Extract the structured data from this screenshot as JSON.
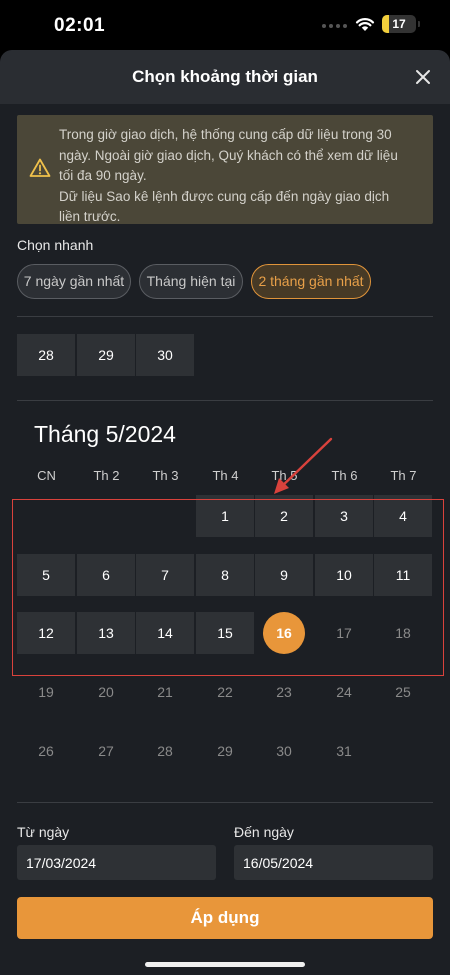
{
  "status_bar": {
    "time": "02:01",
    "battery": "17",
    "battery_level": 0.17,
    "battery_color": "#f2cf3c"
  },
  "sheet": {
    "title": "Chọn khoảng thời gian",
    "close_icon": "close-icon"
  },
  "notice": {
    "icon": "warning-icon",
    "lines": [
      "Trong giờ giao dịch, hệ thống cung cấp dữ liệu trong 30",
      "ngày. Ngoài giờ giao dịch, Quý khách có thể xem dữ liệu",
      "tối đa 90 ngày.",
      "Dữ liệu Sao kê lệnh được cung cấp đến ngày giao dịch",
      "liền trước."
    ]
  },
  "quick_select": {
    "label": "Chọn nhanh",
    "options": [
      "7 ngày gần nhất",
      "Tháng hiện tại",
      "2 tháng gần nhất"
    ],
    "active_index": 2
  },
  "previous_month_tail": [
    "28",
    "29",
    "30"
  ],
  "calendar": {
    "title": "Tháng 5/2024",
    "weekdays": [
      "CN",
      "Th 2",
      "Th 3",
      "Th 4",
      "Th 5",
      "Th 6",
      "Th 7"
    ],
    "weeks": [
      [
        "",
        "",
        "",
        "1",
        "2",
        "3",
        "4"
      ],
      [
        "5",
        "6",
        "7",
        "8",
        "9",
        "10",
        "11"
      ],
      [
        "12",
        "13",
        "14",
        "15",
        "16",
        "17",
        "18"
      ],
      [
        "19",
        "20",
        "21",
        "22",
        "23",
        "24",
        "25"
      ],
      [
        "26",
        "27",
        "28",
        "29",
        "30",
        "31",
        ""
      ]
    ],
    "selected_day": "16",
    "range_end_week": 2
  },
  "form": {
    "from_label": "Từ ngày",
    "from_value": "17/03/2024",
    "to_label": "Đến ngày",
    "to_value": "16/05/2024"
  },
  "apply_button": "Áp dụng",
  "colors": {
    "accent": "#e8963a",
    "annotation": "#d9423c",
    "background": "#1c1f24"
  }
}
